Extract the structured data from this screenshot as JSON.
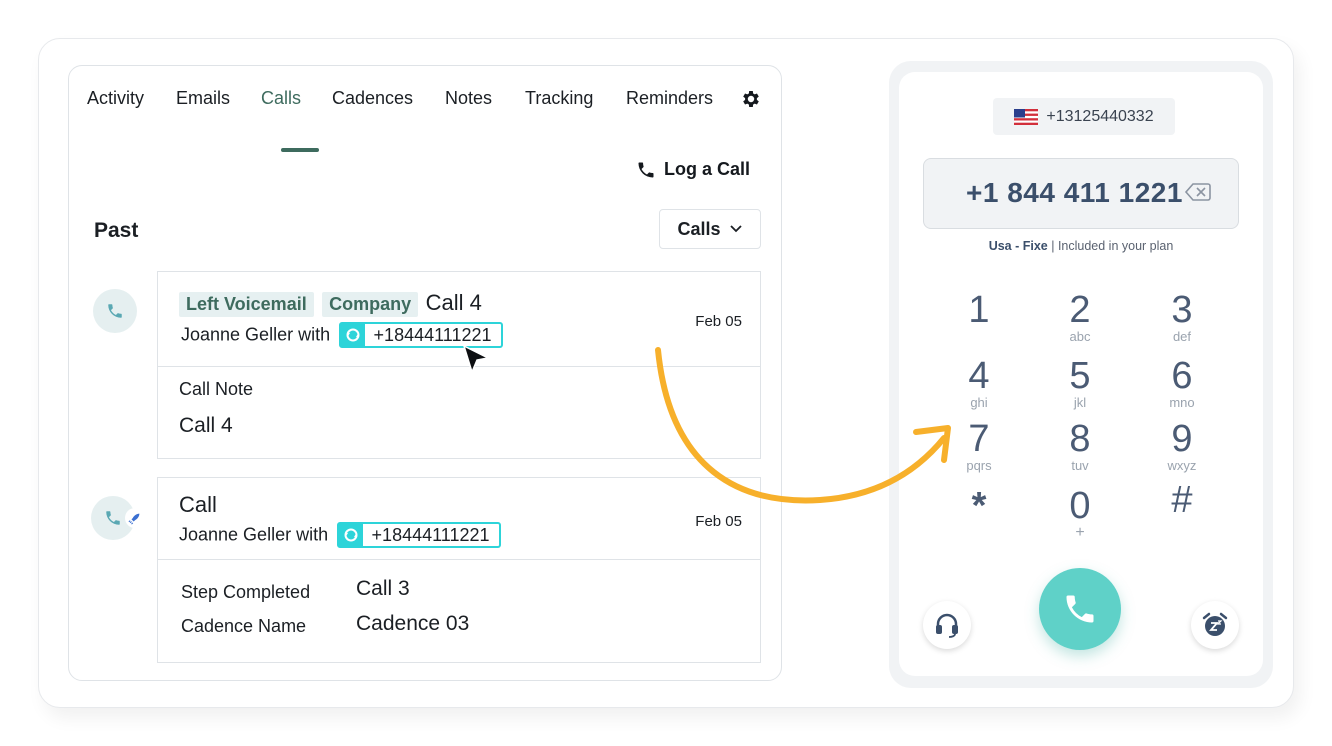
{
  "tabs": [
    {
      "label": "Activity"
    },
    {
      "label": "Emails"
    },
    {
      "label": "Calls"
    },
    {
      "label": "Cadences"
    },
    {
      "label": "Notes"
    },
    {
      "label": "Tracking"
    },
    {
      "label": "Reminders"
    }
  ],
  "active_tab": "Calls",
  "log_call_label": "Log a Call",
  "section_title": "Past",
  "filter_dropdown": "Calls",
  "activities": [
    {
      "tag1": "Left Voicemail",
      "tag2": "Company",
      "title": "Call 4",
      "contact": "Joanne Geller with",
      "number": "+18444111221",
      "date": "Feb 05",
      "note_label": "Call Note",
      "note_value": "Call 4"
    },
    {
      "title": "Call",
      "contact": "Joanne Geller with",
      "number": "+18444111221",
      "date": "Feb 05",
      "step_label": "Step Completed",
      "step_value": "Call 3",
      "cadence_label": "Cadence Name",
      "cadence_value": "Cadence 03"
    }
  ],
  "dialer": {
    "from_number": "+13125440332",
    "dialed_number": "+1 844 411 1221",
    "plan_type": "Usa - Fixe",
    "plan_note": "| Included in your plan",
    "keys": [
      {
        "digit": "1",
        "letters": ""
      },
      {
        "digit": "2",
        "letters": "abc"
      },
      {
        "digit": "3",
        "letters": "def"
      },
      {
        "digit": "4",
        "letters": "ghi"
      },
      {
        "digit": "5",
        "letters": "jkl"
      },
      {
        "digit": "6",
        "letters": "mno"
      },
      {
        "digit": "7",
        "letters": "pqrs"
      },
      {
        "digit": "8",
        "letters": "tuv"
      },
      {
        "digit": "9",
        "letters": "wxyz"
      },
      {
        "digit": "*",
        "letters": ""
      },
      {
        "digit": "0",
        "letters": "+"
      },
      {
        "digit": "#",
        "letters": ""
      }
    ]
  },
  "colors": {
    "accent_green": "#3e6b5e",
    "chip_cyan": "#2dd4d9",
    "call_button": "#5fd1c8",
    "arrow": "#f7b02b"
  },
  "icons": [
    "gear-icon",
    "phone-icon",
    "chevron-down-icon",
    "rocket-icon",
    "sync-icon",
    "us-flag-icon",
    "backspace-icon",
    "headset-icon",
    "snooze-alarm-icon"
  ]
}
